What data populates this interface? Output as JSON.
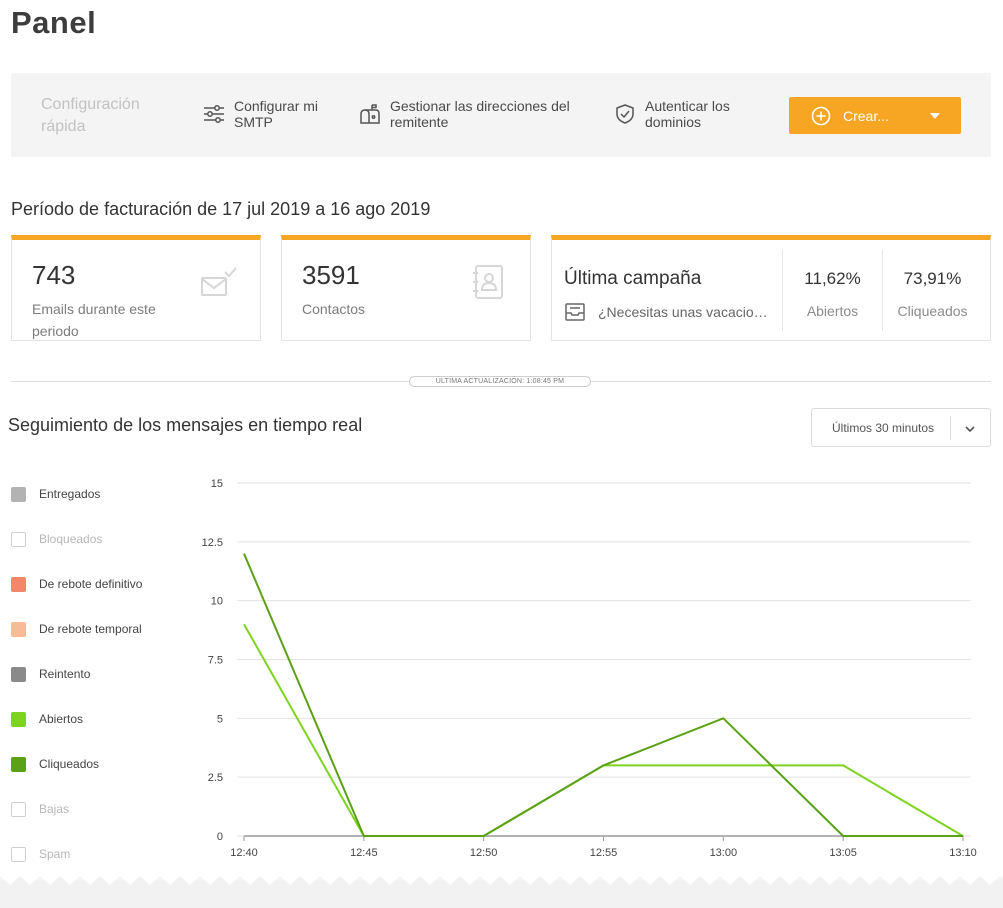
{
  "page": {
    "title": "Panel"
  },
  "quick_config": {
    "title": "Configuración rápida",
    "items": [
      {
        "label": "Configurar mi SMTP",
        "icon": "sliders-icon"
      },
      {
        "label": "Gestionar las direcciones del remitente",
        "icon": "mailbox-icon"
      },
      {
        "label": "Autenticar los dominios",
        "icon": "shield-check-icon"
      }
    ],
    "create_label": "Crear..."
  },
  "billing": {
    "title": "Período de facturación de 17 jul 2019 a 16 ago 2019",
    "emails": {
      "value": "743",
      "label": "Emails durante este periodo"
    },
    "contacts": {
      "value": "3591",
      "label": "Contactos"
    },
    "campaign": {
      "title": "Última campaña",
      "name": "¿Necesitas unas vacaciones?",
      "opened_pct": "11,62%",
      "opened_label": "Abiertos",
      "clicked_pct": "73,91%",
      "clicked_label": "Cliqueados"
    }
  },
  "last_update": "ÚLTIMA ACTUALIZACIÓN: 1:08:45 PM",
  "realtime": {
    "title": "Seguimiento de los mensajes en tiempo real",
    "range_selected": "Últimos 30 minutos",
    "legend": [
      {
        "label": "Entregados",
        "color": "#b3b3b3",
        "active": true
      },
      {
        "label": "Bloqueados",
        "color": "#ffffff",
        "active": false
      },
      {
        "label": "De rebote definitivo",
        "color": "#f4876a",
        "active": true
      },
      {
        "label": "De rebote temporal",
        "color": "#f9bb96",
        "active": true
      },
      {
        "label": "Reintento",
        "color": "#8a8a8a",
        "active": true
      },
      {
        "label": "Abiertos",
        "color": "#7ed321",
        "active": true
      },
      {
        "label": "Cliqueados",
        "color": "#5ba116",
        "active": true
      },
      {
        "label": "Bajas",
        "color": "#ffffff",
        "active": false
      },
      {
        "label": "Spam",
        "color": "#ffffff",
        "active": false
      }
    ]
  },
  "colors": {
    "accent": "#f6a623",
    "opened": "#7ed321",
    "clicked": "#5ba116",
    "delivered": "#b3b3b3"
  },
  "chart_data": {
    "type": "line",
    "x": [
      "12:40",
      "12:45",
      "12:50",
      "12:55",
      "13:00",
      "13:05",
      "13:10"
    ],
    "y_ticks": [
      "0",
      "2.5",
      "5",
      "7.5",
      "10",
      "12.5",
      "15"
    ],
    "ylim": [
      0,
      15
    ],
    "grid": true,
    "series": [
      {
        "name": "Entregados",
        "color": "#b3b3b3",
        "values": [
          0,
          0,
          0,
          0,
          0,
          0,
          0
        ]
      },
      {
        "name": "Abiertos",
        "color": "#7ed321",
        "values": [
          9,
          0,
          0,
          3,
          3,
          3,
          0
        ]
      },
      {
        "name": "Cliqueados",
        "color": "#5ba116",
        "values": [
          12,
          0,
          0,
          3,
          5,
          0,
          0
        ]
      }
    ]
  }
}
